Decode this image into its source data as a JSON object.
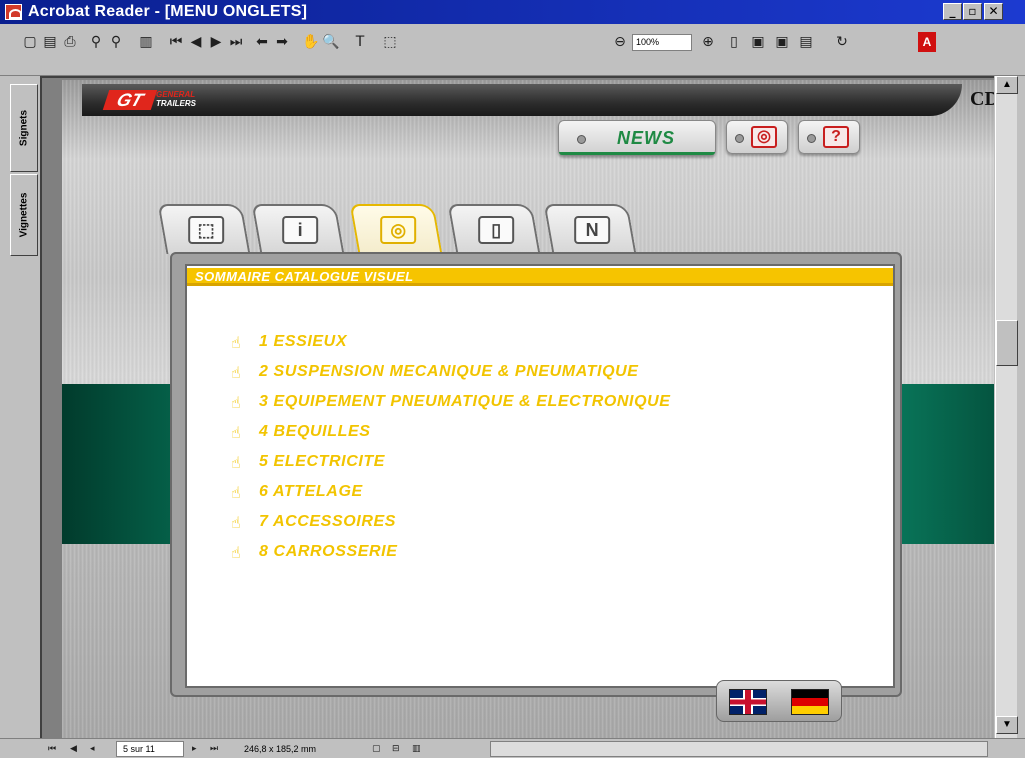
{
  "window": {
    "title": "Acrobat Reader - [MENU ONGLETS]",
    "controls": {
      "minimize": "_",
      "restore": "▫",
      "close": "✕"
    }
  },
  "toolbar": {
    "icons": [
      "open-icon",
      "save-icon",
      "print-icon",
      "find-icon",
      "search-icon",
      "bookmarks-panel-icon",
      "first-page-icon",
      "prev-page-icon",
      "next-page-icon",
      "last-page-icon",
      "go-back-icon",
      "go-forward-icon",
      "hand-tool-icon",
      "zoom-tool-icon",
      "text-select-icon",
      "graphics-select-icon",
      "zoom-out-icon",
      "zoom-in-icon",
      "actual-size-icon",
      "fit-page-icon",
      "fit-width-icon",
      "reflow-icon",
      "rotate-icon",
      "acrobat-logo-icon"
    ],
    "zoom_value": "100%"
  },
  "side_tabs": {
    "bookmarks": "Signets",
    "thumbnails": "Vignettes"
  },
  "document": {
    "brand_main": "GT",
    "brand_sub_1": "GENERAL",
    "brand_sub_2": "TRAILERS",
    "cd_label": "CD",
    "news_label": "NEWS",
    "tabs": [
      {
        "name": "tab-product",
        "glyph": "⬚",
        "active": false
      },
      {
        "name": "tab-info",
        "glyph": "i",
        "active": false
      },
      {
        "name": "tab-visual",
        "glyph": "◎",
        "active": true
      },
      {
        "name": "tab-document",
        "glyph": "▯",
        "active": false
      },
      {
        "name": "tab-numeric",
        "glyph": "N",
        "active": false
      }
    ],
    "panel_title": "SOMMAIRE CATALOGUE VISUEL",
    "menu_items": [
      "1 ESSIEUX",
      "2 SUSPENSION MECANIQUE & PNEUMATIQUE",
      "3 EQUIPEMENT PNEUMATIQUE & ELECTRONIQUE",
      "4 BEQUILLES",
      "5 ELECTRICITE",
      "6 ATTELAGE",
      "7 ACCESSOIRES",
      "8 CARROSSERIE"
    ],
    "languages": [
      "english-flag",
      "german-flag"
    ]
  },
  "status": {
    "page_indicator": "5 sur 11",
    "page_size": "246,8 x 185,2 mm"
  }
}
